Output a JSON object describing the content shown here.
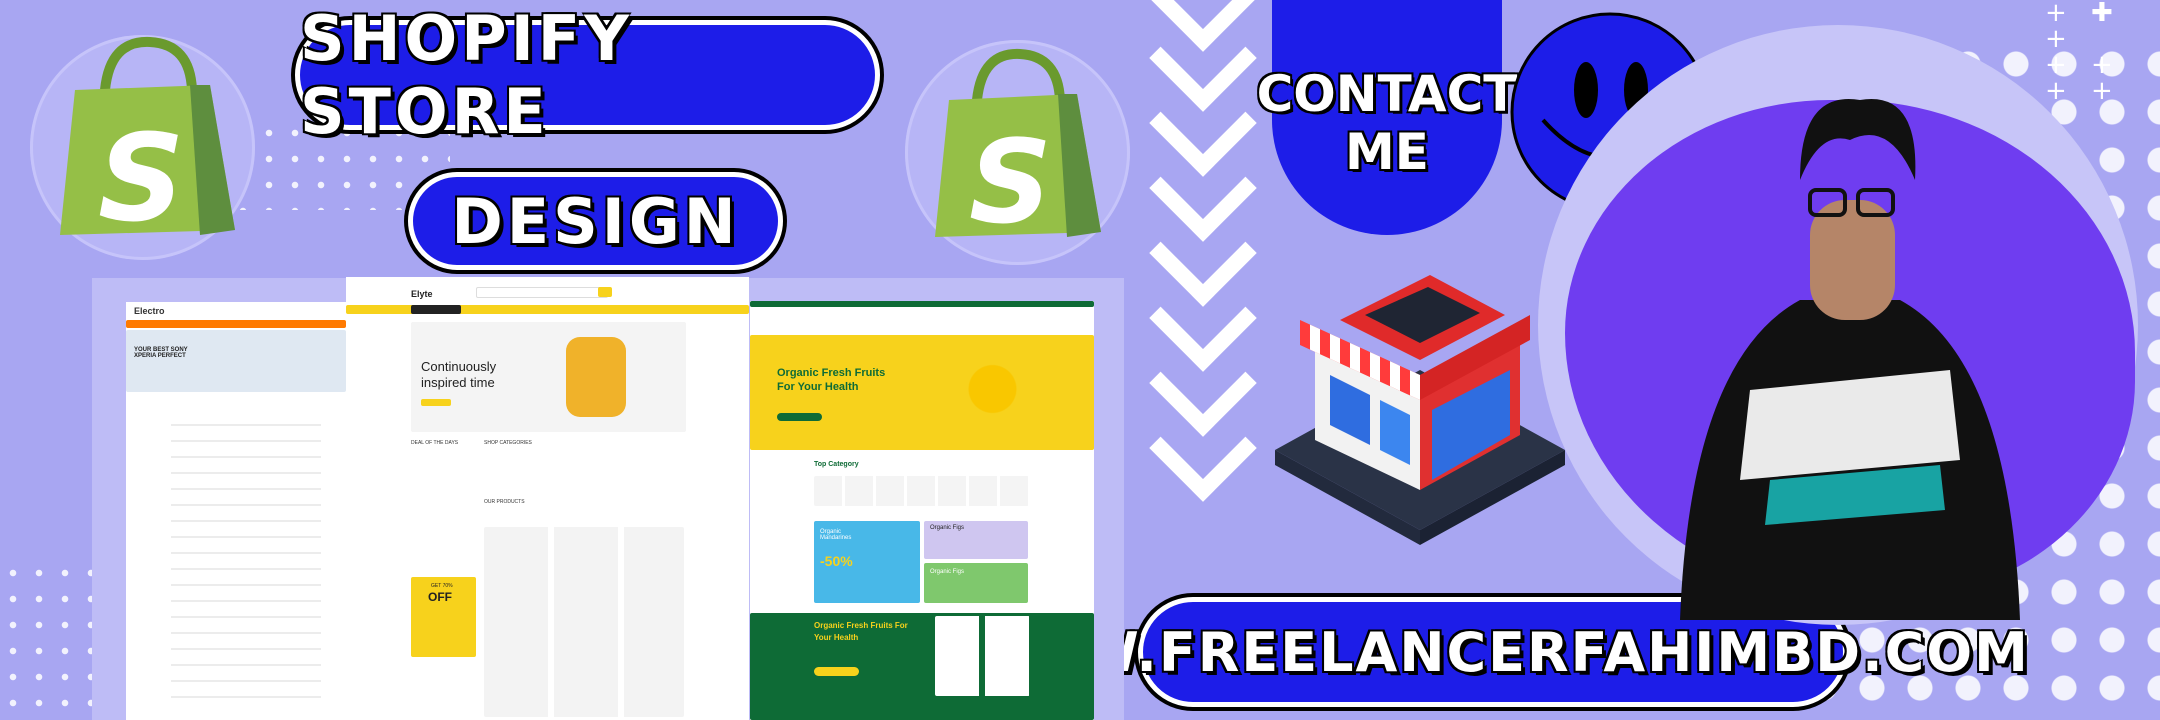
{
  "banner": {
    "title_line1": "SHOPIFY STORE",
    "title_line2": "DESIGN",
    "contact_line1": "CONTACT",
    "contact_line2": "ME",
    "website": "WWW.FREELANCERFAHIMBD.COM"
  },
  "logo": {
    "letter": "S"
  },
  "mockup_electronics": {
    "brand": "Electro",
    "hero": "YOUR BEST SONY XPERIA PERFECT"
  },
  "mockup_elyte": {
    "brand": "Elyte",
    "hero_line1": "Continuously",
    "hero_line2": "inspired time",
    "deal": "DEAL OF THE DAYS",
    "categories": "SHOP CATEGORIES",
    "our_products": "OUR PRODUCTS",
    "promo_small": "GET 70%",
    "promo_big": "OFF"
  },
  "mockup_grocery": {
    "hero_line1": "Organic Fresh Fruits",
    "hero_line2": "For Your Health",
    "top_category": "Top Category",
    "card1_title": "Organic Mandarines",
    "card1_discount": "-50%",
    "card2_title": "Organic Figs",
    "card3_title": "Organic Figs",
    "promo_line1": "Organic Fresh Fruits For",
    "promo_line2": "Your Health"
  },
  "colors": {
    "background": "#a8a6f2",
    "pill": "#1d1de8",
    "shopify_green": "#95bf47",
    "yellow": "#f7d21c",
    "dark_green": "#0e6b36"
  }
}
